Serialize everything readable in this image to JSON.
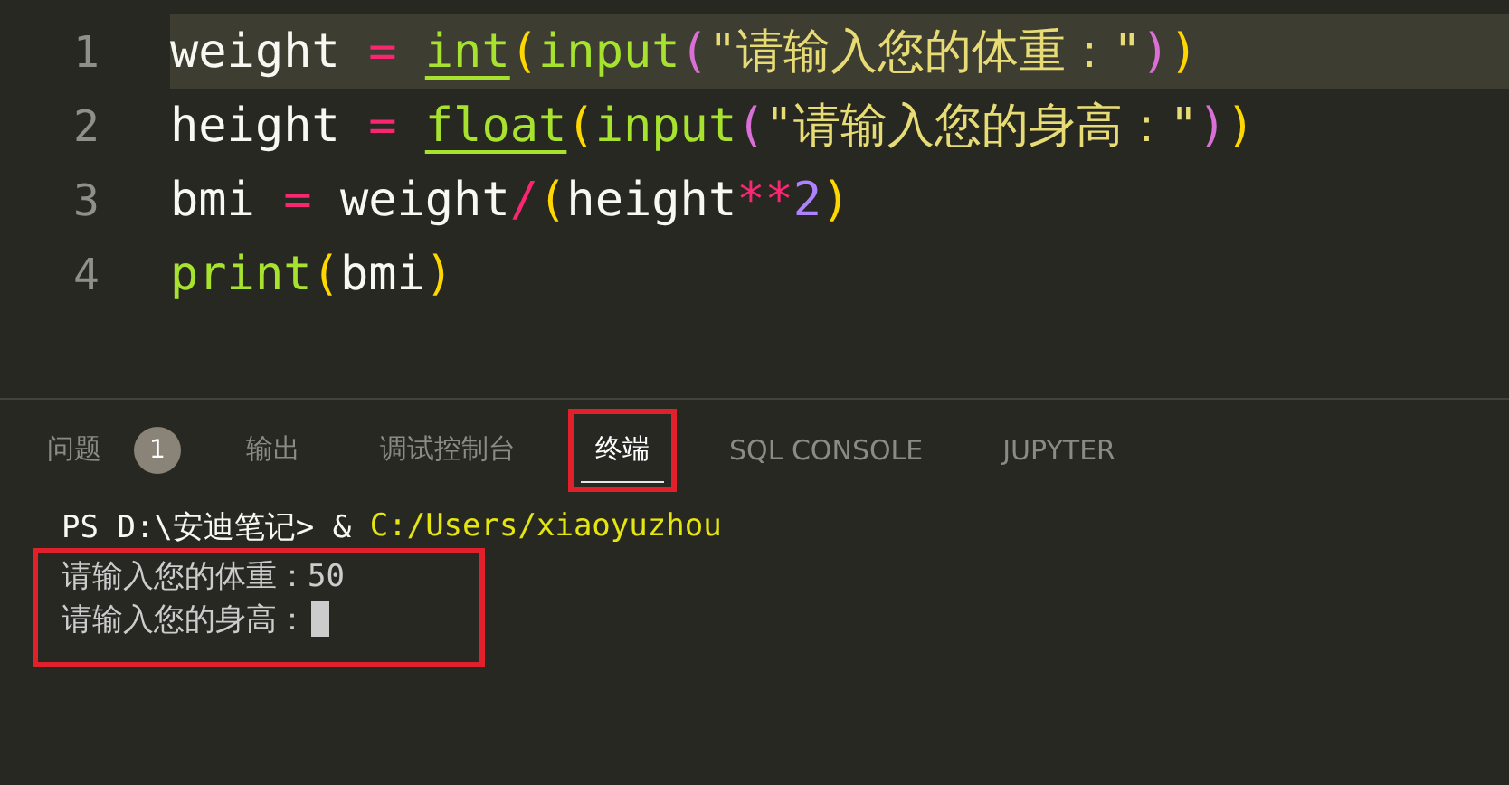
{
  "editor": {
    "lines": [
      {
        "number": "1",
        "current": true,
        "tokens": [
          {
            "kind": "plain",
            "text": "weight"
          },
          {
            "kind": "op",
            "text": " = "
          },
          {
            "kind": "builtin",
            "text": "int"
          },
          {
            "kind": "paren1",
            "text": "("
          },
          {
            "kind": "func",
            "text": "input"
          },
          {
            "kind": "paren2",
            "text": "("
          },
          {
            "kind": "string",
            "text": "\"请输入您的体重：\""
          },
          {
            "kind": "paren2",
            "text": ")"
          },
          {
            "kind": "paren1",
            "text": ")"
          }
        ]
      },
      {
        "number": "2",
        "current": false,
        "tokens": [
          {
            "kind": "plain",
            "text": "height"
          },
          {
            "kind": "op",
            "text": " = "
          },
          {
            "kind": "builtin",
            "text": "float"
          },
          {
            "kind": "paren1",
            "text": "("
          },
          {
            "kind": "func",
            "text": "input"
          },
          {
            "kind": "paren2",
            "text": "("
          },
          {
            "kind": "string",
            "text": "\"请输入您的身高：\""
          },
          {
            "kind": "paren2",
            "text": ")"
          },
          {
            "kind": "paren1",
            "text": ")"
          }
        ]
      },
      {
        "number": "3",
        "current": false,
        "tokens": [
          {
            "kind": "plain",
            "text": "bmi"
          },
          {
            "kind": "op",
            "text": " = "
          },
          {
            "kind": "plain",
            "text": "weight"
          },
          {
            "kind": "op",
            "text": "/"
          },
          {
            "kind": "paren1",
            "text": "("
          },
          {
            "kind": "plain",
            "text": "height"
          },
          {
            "kind": "op",
            "text": "**"
          },
          {
            "kind": "number",
            "text": "2"
          },
          {
            "kind": "paren1",
            "text": ")"
          }
        ]
      },
      {
        "number": "4",
        "current": false,
        "tokens": [
          {
            "kind": "func",
            "text": "print"
          },
          {
            "kind": "paren1",
            "text": "("
          },
          {
            "kind": "plain",
            "text": "bmi"
          },
          {
            "kind": "paren1",
            "text": ")"
          }
        ]
      }
    ]
  },
  "panel": {
    "tabs": [
      {
        "label": "问题",
        "badge": "1",
        "selected": false,
        "highlighted": false
      },
      {
        "label": "输出",
        "selected": false,
        "highlighted": false
      },
      {
        "label": "调试控制台",
        "selected": false,
        "highlighted": false
      },
      {
        "label": "终端",
        "selected": true,
        "highlighted": true
      },
      {
        "label": "SQL CONSOLE",
        "selected": false,
        "highlighted": false
      },
      {
        "label": "JUPYTER",
        "selected": false,
        "highlighted": false
      }
    ],
    "terminal": {
      "command_line": [
        {
          "kind": "plain",
          "text": "PS D:\\安迪笔记> & "
        },
        {
          "kind": "path",
          "text": "C:/Users/xiaoyuzhou"
        }
      ],
      "output_highlighted": true,
      "output": [
        "请输入您的体重：50",
        "请输入您的身高："
      ]
    }
  }
}
